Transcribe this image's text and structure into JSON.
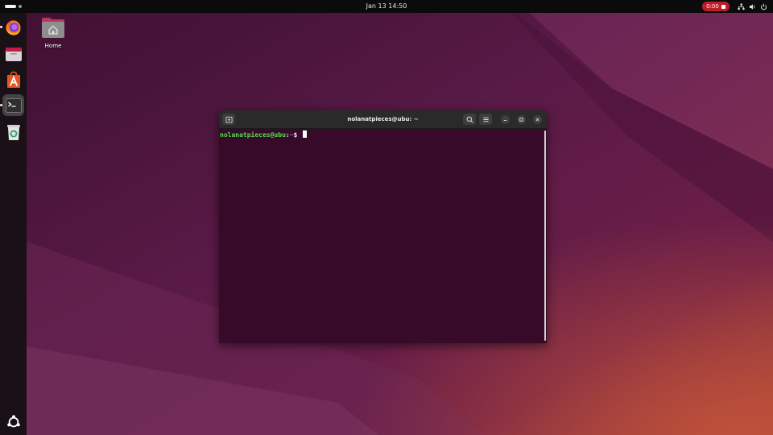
{
  "topbar": {
    "clock": "Jan 13  14:50",
    "recording_timer": "0:00",
    "icons": [
      "activities-indicator",
      "network-icon",
      "volume-icon",
      "power-icon"
    ]
  },
  "dock": {
    "items": [
      {
        "name": "firefox",
        "icon": "firefox-icon",
        "running": true,
        "active": false
      },
      {
        "name": "files",
        "icon": "files-icon",
        "running": false,
        "active": false
      },
      {
        "name": "app-center",
        "icon": "app-center-icon",
        "running": false,
        "active": false
      },
      {
        "name": "terminal",
        "icon": "terminal-icon",
        "running": true,
        "active": true
      },
      {
        "name": "trash",
        "icon": "trash-icon",
        "running": false,
        "active": false
      }
    ],
    "apps_grid_icon": "ubuntu-logo-icon"
  },
  "desktop": {
    "home_label": "Home"
  },
  "terminal": {
    "title": "nolanatpieces@ubu: ~",
    "prompt_user": "nolanatpieces@ubu",
    "prompt_sep": ":",
    "prompt_path": "~",
    "prompt_symbol": "$",
    "header_buttons": [
      "new-tab-icon",
      "search-icon",
      "menu-icon"
    ],
    "window_buttons": [
      "minimize-icon",
      "maximize-icon",
      "close-icon"
    ]
  },
  "colors": {
    "wallpaper_base": "#3a0f2f",
    "terminal_bg": "#380a2a",
    "prompt_user": "#4ee04a",
    "prompt_path": "#5f8fe0",
    "recording": "#c01c28",
    "dock_bg": "#1a1117",
    "header_bg": "#2a2a2a"
  }
}
